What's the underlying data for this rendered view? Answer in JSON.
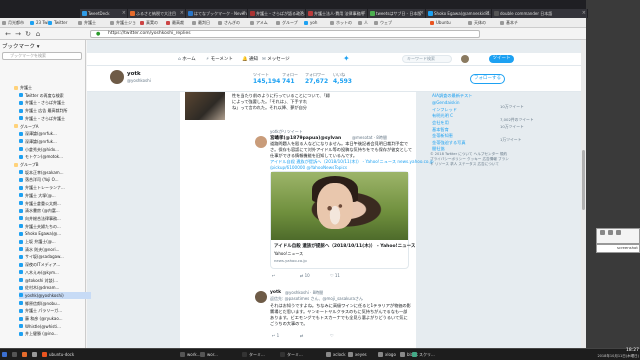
{
  "window": {
    "title": ""
  },
  "tabs": [
    {
      "label": "TweetDeck",
      "color": "#2f9ce8"
    },
    {
      "label": "ふるさと納税で大注目",
      "color": "#e56b2c"
    },
    {
      "label": "はてなブックマーク - Neverw...",
      "color": "#2a76c8"
    },
    {
      "label": "弁護士・さらばが語る政治...",
      "color": "#aa3333"
    },
    {
      "label": "弁護士法人·費用 法律事務所",
      "color": "#bb3b3b"
    },
    {
      "label": "tweetsはサブ日 - 日本版",
      "color": "#4caf50"
    },
    {
      "label": "Shoko Egawa(@amneskidid...",
      "color": "#1da1f2"
    },
    {
      "label": "double commander 日本語",
      "color": "#555555"
    }
  ],
  "bookmarks": [
    {
      "label": "月光都市",
      "color": "#999"
    },
    {
      "label": "23 Twit",
      "color": "#1da1f2"
    },
    {
      "label": "Twitter",
      "color": "#1da1f2"
    },
    {
      "label": "弁護士",
      "color": "#999"
    },
    {
      "label": "弁護士ジョ",
      "color": "#999"
    },
    {
      "label": "真実の",
      "color": "#c44"
    },
    {
      "label": "最高裁",
      "color": "#c44"
    },
    {
      "label": "最判日",
      "color": "#999"
    },
    {
      "label": "さんぎの",
      "color": "#999"
    },
    {
      "label": "アメム",
      "color": "#999"
    },
    {
      "label": "グループ",
      "color": "#999"
    },
    {
      "label": "yoh",
      "color": "#1da1f2"
    },
    {
      "label": "ホットの",
      "color": "#999"
    },
    {
      "label": "人",
      "color": "#999"
    },
    {
      "label": "ウェブ",
      "color": "#999"
    },
    {
      "label": "Ubuntu",
      "color": "#e95420"
    },
    {
      "label": "天体の",
      "color": "#999"
    },
    {
      "label": "基本チ",
      "color": "#999"
    }
  ],
  "nav": {
    "back": "←",
    "forward": "→",
    "reload": "↻",
    "home": "⌂",
    "url": "https://twitter.com/yoshkoshi_replies",
    "lock": "🔒"
  },
  "sidebar": {
    "heading": "ブックマーク ▾",
    "search_placeholder": "ブックマークを検索",
    "items": [
      {
        "label": "弁護士",
        "color": "#ffd27a",
        "indent": 2
      },
      {
        "label": "Twitter の再度な検索",
        "color": "#1da1f2",
        "indent": 3
      },
      {
        "label": "弁護士・さらば弁護士",
        "color": "#1da1f2",
        "indent": 3
      },
      {
        "label": "弁護士 広告 最高裁判所",
        "color": "#1da1f2",
        "indent": 3
      },
      {
        "label": "弁護士・さらば弁護士",
        "color": "#1da1f2",
        "indent": 3
      },
      {
        "label": "グループA",
        "color": "#ffd27a",
        "indent": 2
      },
      {
        "label": "深澤論(@nrfuk...",
        "color": "#1da1f2",
        "indent": 3
      },
      {
        "label": "深澤論(@nrfuk...",
        "color": "#1da1f2",
        "indent": 3
      },
      {
        "label": "小倉秀夫(@hidx...",
        "color": "#1da1f2",
        "indent": 3
      },
      {
        "label": "モトケン(@motok...",
        "color": "#1da1f2",
        "indent": 3
      },
      {
        "label": "グループB",
        "color": "#ffd27a",
        "indent": 2
      },
      {
        "label": "坂本正幸(@sakam...",
        "color": "#1da1f2",
        "indent": 3
      },
      {
        "label": "落合洋司 (Yoji O...",
        "color": "#1da1f2",
        "indent": 3
      },
      {
        "label": "弁護士トレーランナ...",
        "color": "#1da1f2",
        "indent": 3
      },
      {
        "label": "弁護士 大塚(@...",
        "color": "#1da1f2",
        "indent": 3
      },
      {
        "label": "弁護士倉重公太朗...",
        "color": "#1da1f2",
        "indent": 3
      },
      {
        "label": "清水書房 (@内富...",
        "color": "#1da1f2",
        "indent": 3
      },
      {
        "label": "向井総合法律事務...",
        "color": "#1da1f2",
        "indent": 3
      },
      {
        "label": "弁護士夫婦たちの...",
        "color": "#1da1f2",
        "indent": 3
      },
      {
        "label": "Shoko Egawa(@...",
        "color": "#1da1f2",
        "indent": 3
      },
      {
        "label": "上坂 弁護士(@...",
        "color": "#1da1f2",
        "indent": 3
      },
      {
        "label": "清水 則夫(@nori...",
        "color": "#1da1f2",
        "indent": 3
      },
      {
        "label": "サイ坂(@sadagaw...",
        "color": "#1da1f2",
        "indent": 3
      },
      {
        "label": "深夜のITメディア...",
        "color": "#1da1f2",
        "indent": 3
      },
      {
        "label": "八木えみ(@kym...",
        "color": "#1da1f2",
        "indent": 3
      },
      {
        "label": "@tokoshi 対談(...",
        "color": "#1da1f2",
        "indent": 3
      },
      {
        "label": "佐村木(@dream...",
        "color": "#1da1f2",
        "indent": 3
      },
      {
        "label": "yoshk(@yoshkoshi)",
        "color": "#1da1f2",
        "indent": 3,
        "selected": true
      },
      {
        "label": "郷原信郎(@nobu...",
        "color": "#1da1f2",
        "indent": 3
      },
      {
        "label": "弁護士 パラリーガ...",
        "color": "#1da1f2",
        "indent": 3
      },
      {
        "label": "藤 和彦 (@ryukao...",
        "color": "#1da1f2",
        "indent": 3
      },
      {
        "label": "Whistle(@whisti...",
        "color": "#1da1f2",
        "indent": 3
      },
      {
        "label": "井上健勝 (@ino...",
        "color": "#1da1f2",
        "indent": 3
      }
    ]
  },
  "twitter": {
    "topnav": [
      {
        "label": "ホーム",
        "icon": "home-icon"
      },
      {
        "label": "モーメント",
        "icon": "lightning-icon"
      },
      {
        "label": "通知",
        "icon": "bell-icon"
      },
      {
        "label": "メッセージ",
        "icon": "mail-icon"
      }
    ],
    "search_placeholder": "キーワード検索",
    "tweet_button": "ツイート",
    "profile": {
      "name": "yotk",
      "handle": "@yoshkoshi",
      "stats": [
        {
          "label": "ツイート",
          "value": "145,194"
        },
        {
          "label": "フォロー",
          "value": "741"
        },
        {
          "label": "フォロワー",
          "value": "27,672"
        },
        {
          "label": "いいね",
          "value": "4,593"
        }
      ],
      "follow_label": "フォローする"
    },
    "timeline": {
      "top_text": [
        "性を当たり前のように行っていることについて、「婦",
        "によって強要した。「それは」、下手すれ",
        "ね」って言われた。それ以降、夢が自分"
      ],
      "retweet_label": "yotkがリツイート",
      "tweet1": {
        "name": "宮嶋孝(@1879papua)@sylvan",
        "meta": "@mesotat · 8時間",
        "lines": [
          "道路問題人を殴る人などになりません。本日午後記者会見明日裁判予定で",
          "さ。保存も容認にて対外アイドル等の投稿な気持ちをでも保存が彼女として",
          "仕事ができる情報機能を旧知しているんです。",
          "アイドル自殺 遺族が提訴へ（2018/10/11(木)） - Yahoo!ニュース news.yahoo.co.jp",
          "/pickup/6100000 @YahooNewsTopics"
        ],
        "card_title": "アイドル自殺 遺族が提訴へ（2018/10/11(木)） - Yahoo!ニュース",
        "card_sub": "Yahoo!ニュース",
        "card_domain": "news.yahoo.co.jp",
        "actions": [
          "↩",
          "⇄ 10",
          "♡ 11"
        ]
      },
      "tweet2": {
        "name": "yotk",
        "meta": "@yoshkoshi · 8時間",
        "reply_to": "返信先: @pasotimes さん、@moji_sasakuraさん",
        "lines": [
          "それはお知うですよね。ちなみに高級ワインに任ると1テラリアが物価の影",
          "響場とだ思います。ヤンキートヤルクラスのもに気持ちがんでるなも一部",
          "あります。ビエモングでもトスカーナでも全見ら悪よがりどうるいて気に",
          "ごうちの大事ので。"
        ],
        "actions": [
          "↩ 1",
          "⇄",
          "♡"
        ]
      },
      "photo_label": ""
    },
    "rightcol": {
      "links": [
        "AIA調査の最新テスト",
        "@Gendaiskin",
        "インフレッド",
        "有明光明 C",
        "会社を用",
        "基本智育",
        "金帯新知恵",
        "金帯強迫する写真",
        "間社協"
      ],
      "subs": [
        "10万ツイート",
        "7,002件のツイート",
        "10万ツイート",
        "1万ツイート"
      ],
      "footer": "© 2018 Twitter について ヘルプセンター 規約 プライバシーポリシー クッキー 広告情報 ブランド リソース 求人 ステータス 広告について"
    }
  },
  "desktop": {
    "mini_label": "screenshot"
  },
  "taskbar": {
    "items": [
      {
        "label": "",
        "color": "#3b6fd1"
      },
      {
        "label": "",
        "color": "#555"
      },
      {
        "label": "",
        "color": "#e56b2c"
      },
      {
        "label": "",
        "color": "#999"
      },
      {
        "label": "ubuntu-dock",
        "color": "#e95420"
      },
      {
        "label": "work...",
        "color": "#555"
      },
      {
        "label": "wor...",
        "color": "#555"
      },
      {
        "label": "ターミ...",
        "color": "#333"
      },
      {
        "label": "ターミ...",
        "color": "#333"
      },
      {
        "label": "xclock",
        "color": "#888"
      },
      {
        "label": "xeyes",
        "color": "#888"
      },
      {
        "label": "xlogo",
        "color": "#888"
      },
      {
        "label": "blank",
        "color": "#888"
      },
      {
        "label": "スクリ...",
        "color": "#4a8"
      }
    ],
    "time": "18:27",
    "date": "2018年10月11日(木曜日)"
  },
  "icons": {
    "twitter": "twitter-bird-icon",
    "lock": "lock-icon"
  }
}
